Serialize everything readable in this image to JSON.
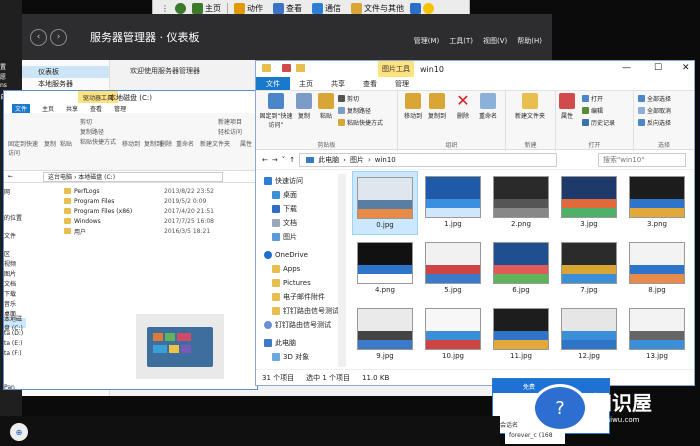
{
  "remote_toolbar": {
    "items": [
      {
        "label": "主页",
        "icon": "home-icon",
        "color": "#3a7a2a"
      },
      {
        "label": "动作",
        "icon": "lightning-icon",
        "color": "#e09a00"
      },
      {
        "label": "查看",
        "icon": "view-icon",
        "color": "#3b74c4"
      },
      {
        "label": "通信",
        "icon": "chat-icon",
        "color": "#2e7fd4"
      },
      {
        "label": "文件与其他",
        "icon": "folder-icon",
        "color": "#d9a534"
      }
    ]
  },
  "desktop": {
    "labels": [
      "置",
      "愿",
      "ns",
      "自动"
    ]
  },
  "server_manager": {
    "title": "服务器管理器 · 仪表板",
    "menus": [
      "管理(M)",
      "工具(T)",
      "视图(V)",
      "帮助(H)"
    ],
    "nav": [
      "仪表板",
      "本地服务器"
    ],
    "welcome": "欢迎使用服务器管理器"
  },
  "explorer_c": {
    "title": "本地磁盘 (C:)",
    "context_tab": "驱动器工具",
    "tabs": [
      "文件",
      "主页",
      "共享",
      "查看",
      "管理"
    ],
    "ribbon": [
      "固定到快速访问",
      "复制",
      "粘贴",
      "剪切",
      "复制路径",
      "粘贴快捷方式",
      "移动到",
      "复制到",
      "删除",
      "重命名",
      "新建文件夹",
      "新建项目",
      "轻松访问",
      "属性"
    ],
    "address": "这台电脑 › 本地磁盘 (C:)",
    "side": [
      "网",
      "的位置",
      "文件",
      "区",
      "视频",
      "图片",
      "文档",
      "下载",
      "音乐",
      "桌面",
      "本地磁盘 (C:)",
      "ta (D:)",
      "ta (E:)",
      "ta (F:)",
      "Pan"
    ],
    "files": [
      {
        "name": "PerfLogs",
        "date": "2013/8/22 23:52"
      },
      {
        "name": "Program Files",
        "date": "2019/5/2 0:09"
      },
      {
        "name": "Program Files (x86)",
        "date": "2017/4/20 21:51"
      },
      {
        "name": "Windows",
        "date": "2017/7/25 16:08"
      },
      {
        "name": "用户",
        "date": "2016/3/5 18:21"
      }
    ]
  },
  "explorer_win10": {
    "title": "win10",
    "context_tab": "图片工具",
    "tabs": [
      "文件",
      "主页",
      "共享",
      "查看",
      "管理"
    ],
    "ribbon": {
      "clipboard": {
        "label": "剪贴板",
        "pin": "固定到“快速访问”",
        "copy": "复制",
        "paste": "粘贴",
        "cut": "剪切",
        "copy_path": "复制路径",
        "paste_shortcut": "粘贴快捷方式"
      },
      "organize": {
        "label": "组织",
        "move": "移动到",
        "copyto": "复制到",
        "delete": "删除",
        "rename": "重命名"
      },
      "new": {
        "label": "新建",
        "folder": "新建文件夹"
      },
      "open": {
        "label": "打开",
        "properties": "属性",
        "open": "打开",
        "edit": "编辑",
        "history": "历史记录"
      },
      "select": {
        "label": "选择",
        "all": "全部选择",
        "none": "全部取消",
        "invert": "反向选择"
      }
    },
    "path": [
      "此电脑",
      "图片",
      "win10"
    ],
    "search_placeholder": "搜索\"win10\"",
    "nav": [
      "快速访问",
      "桌面",
      "下载",
      "文档",
      "图片",
      "OneDrive",
      "Apps",
      "Pictures",
      "电子邮件附件",
      "钉钉路由信号测试",
      "钉钉路由信号测试",
      "此电脑",
      "3D 对象"
    ],
    "files": [
      "0.jpg",
      "1.jpg",
      "2.png",
      "3.jpg",
      "3.png",
      "4.png",
      "5.jpg",
      "6.jpg",
      "7.jpg",
      "8.jpg",
      "9.jpg",
      "10.jpg",
      "11.jpg",
      "12.jpg",
      "13.jpg"
    ],
    "status": {
      "count": "31 个项目",
      "selected": "选中 1 个项目",
      "size": "11.0 KB"
    }
  },
  "chat": {
    "header": "免费",
    "contact": "会话名",
    "bottom": "forever_c (168"
  },
  "watermark": {
    "text": "知识屋",
    "url": "zhishiwu.com",
    "logo_letter": "?"
  }
}
